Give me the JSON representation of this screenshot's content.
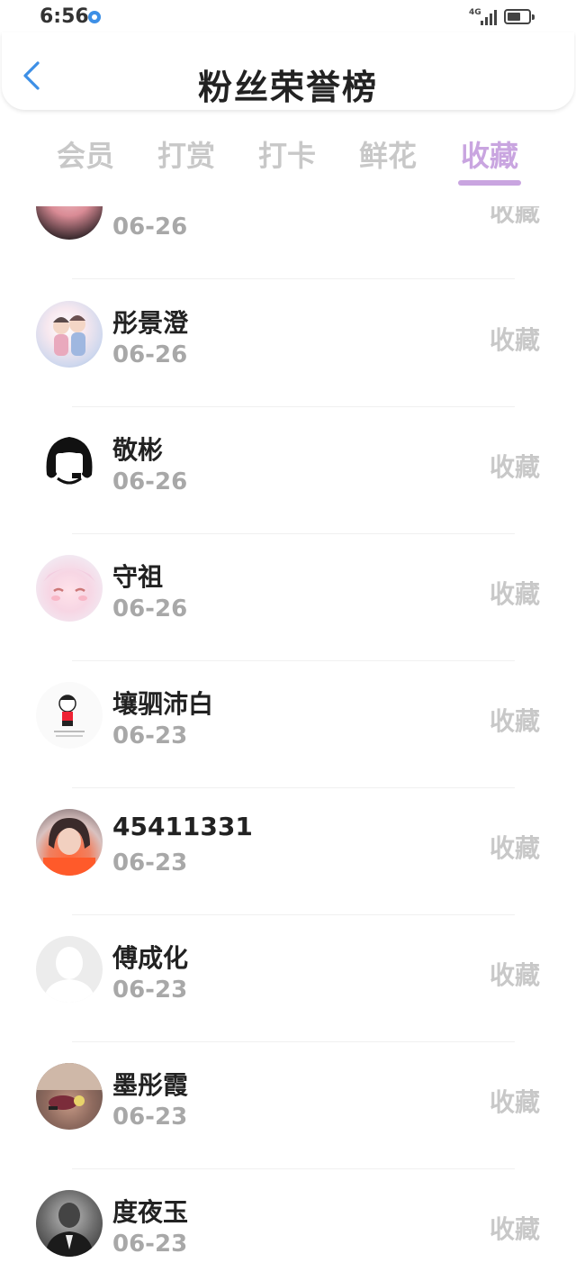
{
  "status": {
    "time": "6:56",
    "network": "4G"
  },
  "header": {
    "title": "粉丝荣誉榜"
  },
  "tabs": [
    {
      "label": "会员",
      "active": false
    },
    {
      "label": "打赏",
      "active": false
    },
    {
      "label": "打卡",
      "active": false
    },
    {
      "label": "鲜花",
      "active": false
    },
    {
      "label": "收藏",
      "active": true
    }
  ],
  "colors": {
    "accent": "#c9a5e0",
    "back_icon": "#3d8fe6",
    "muted": "#c8c8c8"
  },
  "list": [
    {
      "name": "",
      "date": "06-26",
      "action": "收藏",
      "avatar": "avatar-photo-icon"
    },
    {
      "name": "彤景澄",
      "date": "06-26",
      "action": "收藏",
      "avatar": "avatar-anime-couple-icon"
    },
    {
      "name": "敬彬",
      "date": "06-26",
      "action": "收藏",
      "avatar": "avatar-black-hair-girl-icon"
    },
    {
      "name": "守祖",
      "date": "06-26",
      "action": "收藏",
      "avatar": "avatar-anime-girl-icon"
    },
    {
      "name": "壤驷沛白",
      "date": "06-23",
      "action": "收藏",
      "avatar": "avatar-cartoon-boy-icon"
    },
    {
      "name": "45411331",
      "date": "06-23",
      "action": "收藏",
      "avatar": "avatar-photo-girl-icon"
    },
    {
      "name": "傅成化",
      "date": "06-23",
      "action": "收藏",
      "avatar": "avatar-default-icon"
    },
    {
      "name": "墨彤霞",
      "date": "06-23",
      "action": "收藏",
      "avatar": "avatar-photo-toy-icon"
    },
    {
      "name": "度夜玉",
      "date": "06-23",
      "action": "收藏",
      "avatar": "avatar-photo-man-icon"
    }
  ]
}
